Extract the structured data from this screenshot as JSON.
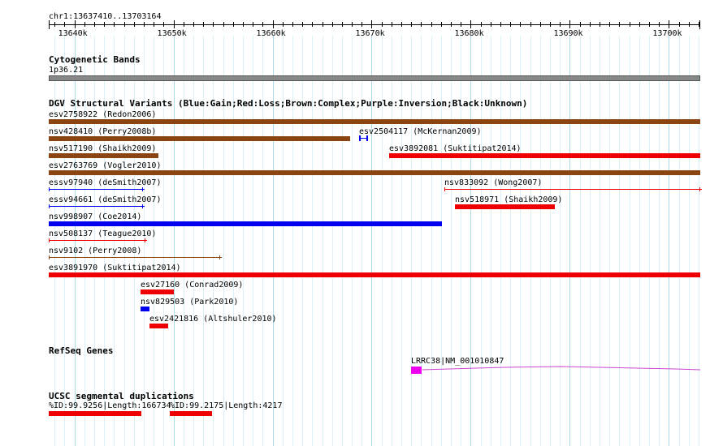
{
  "colors": {
    "gain": "#0000ee",
    "loss": "#ee0000",
    "complex": "#8b4513",
    "gene": "#ee00ee",
    "gene_line": "#cc44cc",
    "band": "#888888",
    "grid": "#a9dbe8",
    "minor_grid": "#d9f0f6"
  },
  "ruler": {
    "label": "chr1:13637410..13703164",
    "ticks": [
      "13640k",
      "13650k",
      "13660k",
      "13670k",
      "13680k",
      "13690k",
      "13700k"
    ]
  },
  "cyto": {
    "title": "Cytogenetic Bands",
    "band_label": "1p36.21"
  },
  "dgv": {
    "title": "DGV Structural Variants (Blue:Gain;Red:Loss;Brown:Complex;Purple:Inversion;Black:Unknown)",
    "features": [
      {
        "label": "esv2758922 (Redon2006)",
        "type": "complex",
        "start": 13637410,
        "end": 13703164,
        "style": "thick",
        "row": 0
      },
      {
        "label": "nsv428410 (Perry2008b)",
        "type": "complex",
        "start": 13637410,
        "end": 13667800,
        "style": "thick",
        "row": 1
      },
      {
        "label": "esv2504117 (McKernan2009)",
        "type": "gain",
        "start": 13668700,
        "end": 13669600,
        "style": "bracket",
        "row": 1
      },
      {
        "label": "nsv517190 (Shaikh2009)",
        "type": "complex",
        "start": 13637410,
        "end": 13648500,
        "style": "thick",
        "row": 2
      },
      {
        "label": "esv3892081 (Suktitipat2014)",
        "type": "loss",
        "start": 13671800,
        "end": 13703164,
        "style": "thick",
        "row": 2
      },
      {
        "label": "esv2763769 (Vogler2010)",
        "type": "complex",
        "start": 13637410,
        "end": 13703164,
        "style": "thick",
        "row": 3
      },
      {
        "label": "essv97940 (deSmith2007)",
        "type": "gain",
        "start": 13637410,
        "end": 13646900,
        "style": "thin",
        "row": 4
      },
      {
        "label": "nsv833092 (Wong2007)",
        "type": "loss",
        "start": 13677300,
        "end": 13703164,
        "style": "thin",
        "row": 4
      },
      {
        "label": "essv94661 (deSmith2007)",
        "type": "gain",
        "start": 13637410,
        "end": 13646900,
        "style": "thin",
        "row": 5
      },
      {
        "label": "nsv518971 (Shaikh2009)",
        "type": "loss",
        "start": 13678400,
        "end": 13688500,
        "style": "thick",
        "row": 5
      },
      {
        "label": "nsv998907 (Coe2014)",
        "type": "gain",
        "start": 13637410,
        "end": 13677100,
        "style": "thick",
        "row": 6
      },
      {
        "label": "nsv508137 (Teague2010)",
        "type": "loss",
        "start": 13637410,
        "end": 13647200,
        "style": "thin",
        "row": 7
      },
      {
        "label": "nsv9102 (Perry2008)",
        "type": "complex",
        "start": 13637410,
        "end": 13654700,
        "style": "thin",
        "row": 8
      },
      {
        "label": "esv3891970 (Suktitipat2014)",
        "type": "loss",
        "start": 13637410,
        "end": 13703164,
        "style": "thick",
        "row": 9
      },
      {
        "label": "esv27160 (Conrad2009)",
        "type": "loss",
        "start": 13646700,
        "end": 13650100,
        "style": "thick",
        "row": 10
      },
      {
        "label": "nsv829503 (Park2010)",
        "type": "gain",
        "start": 13646700,
        "end": 13647600,
        "style": "thick",
        "row": 11
      },
      {
        "label": "esv2421816 (Altshuler2010)",
        "type": "loss",
        "start": 13647600,
        "end": 13649500,
        "style": "thick",
        "row": 12
      }
    ]
  },
  "refseq": {
    "title": "RefSeq Genes",
    "gene_label": "LRRC38|NM_001010847",
    "exon_start": 13674000,
    "exon_end": 13675100,
    "gene_end": 13703164
  },
  "segdup": {
    "title": "UCSC segmental duplications",
    "items": [
      {
        "label": "%ID:99.9256|Length:166734",
        "start": 13637410,
        "end": 13646750
      },
      {
        "label": "%ID:99.2175|Length:4217",
        "start": 13649650,
        "end": 13653950
      }
    ]
  }
}
